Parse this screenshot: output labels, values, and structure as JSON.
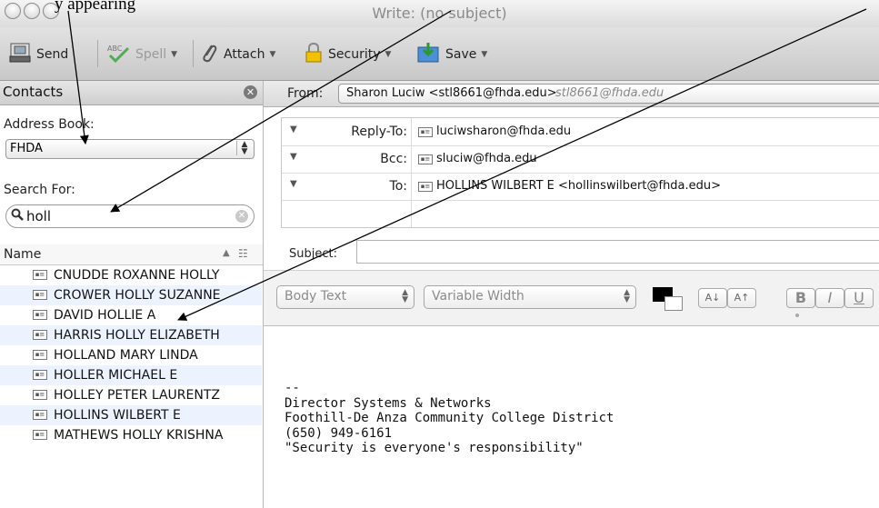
{
  "annotation_text": "y appearing",
  "window": {
    "title": "Write: (no subject)"
  },
  "toolbar": {
    "send": "Send",
    "spell": "Spell",
    "attach": "Attach",
    "security": "Security",
    "save": "Save"
  },
  "contacts": {
    "title": "Contacts",
    "address_book_label": "Address Book:",
    "address_book_value": "FHDA",
    "search_label": "Search For:",
    "search_value": "holl",
    "name_header": "Name",
    "list": [
      "CNUDDE ROXANNE HOLLY",
      "CROWER HOLLY SUZANNE",
      "DAVID HOLLIE A",
      "HARRIS HOLLY ELIZABETH",
      "HOLLAND MARY LINDA",
      "HOLLER MICHAEL E",
      "HOLLEY PETER LAURENTZ",
      "HOLLINS WILBERT E",
      "MATHEWS HOLLY KRISHNA"
    ]
  },
  "compose": {
    "from_label": "From:",
    "from_value": "Sharon Luciw <stl8661@fhda.edu>",
    "from_identity": "stl8661@fhda.edu",
    "recipients": [
      {
        "label": "Reply-To:",
        "value": "luciwsharon@fhda.edu"
      },
      {
        "label": "Bcc:",
        "value": "sluciw@fhda.edu"
      },
      {
        "label": "To:",
        "value": "HOLLINS WILBERT E <hollinswilbert@fhda.edu>"
      }
    ],
    "subject_label": "Subject:",
    "subject_value": "",
    "format": {
      "paragraph_style": "Body Text",
      "font": "Variable Width",
      "smaller": "A↓",
      "larger": "A↑",
      "bold": "B",
      "italic": "I",
      "underline": "U"
    },
    "signature": "--\nDirector Systems & Networks\nFoothill-De Anza Community College District\n(650) 949-6161\n\"Security is everyone's responsibility\""
  }
}
